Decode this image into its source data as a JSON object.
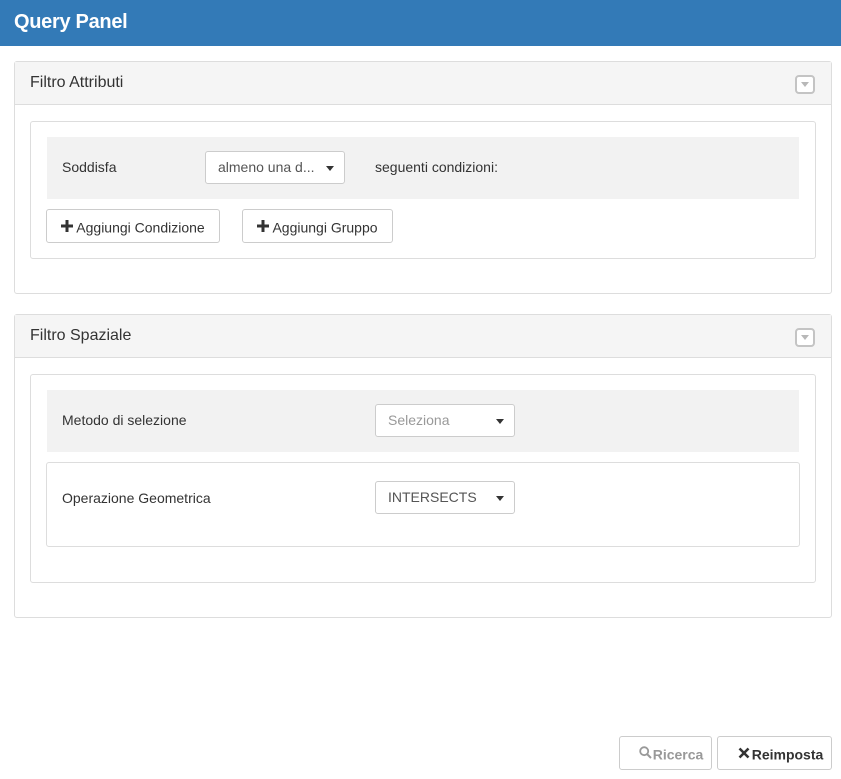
{
  "header": {
    "title": "Query Panel"
  },
  "attribute_filter": {
    "title": "Filtro Attributi",
    "collapse_icon": "chevron-down-icon",
    "match_label": "Soddisfa",
    "match_select_value": "almeno una d...",
    "conditions_text": "seguenti condizioni:",
    "add_condition_label": "Aggiungi Condizione",
    "add_group_label": "Aggiungi Gruppo",
    "add_icon": "plus-icon"
  },
  "spatial_filter": {
    "title": "Filtro Spaziale",
    "collapse_icon": "chevron-down-icon",
    "method_label": "Metodo di selezione",
    "method_placeholder": "Seleziona",
    "geometric_op_label": "Operazione Geometrica",
    "geometric_op_value": "INTERSECTS"
  },
  "footer": {
    "search_label": "Ricerca",
    "search_icon": "search-icon",
    "reset_label": "Reimposta",
    "reset_icon": "close-icon"
  },
  "colors": {
    "header_bg": "#337ab7",
    "panel_heading_bg": "#f5f5f5",
    "row_bg": "#f2f2f2",
    "border": "#dddddd"
  }
}
